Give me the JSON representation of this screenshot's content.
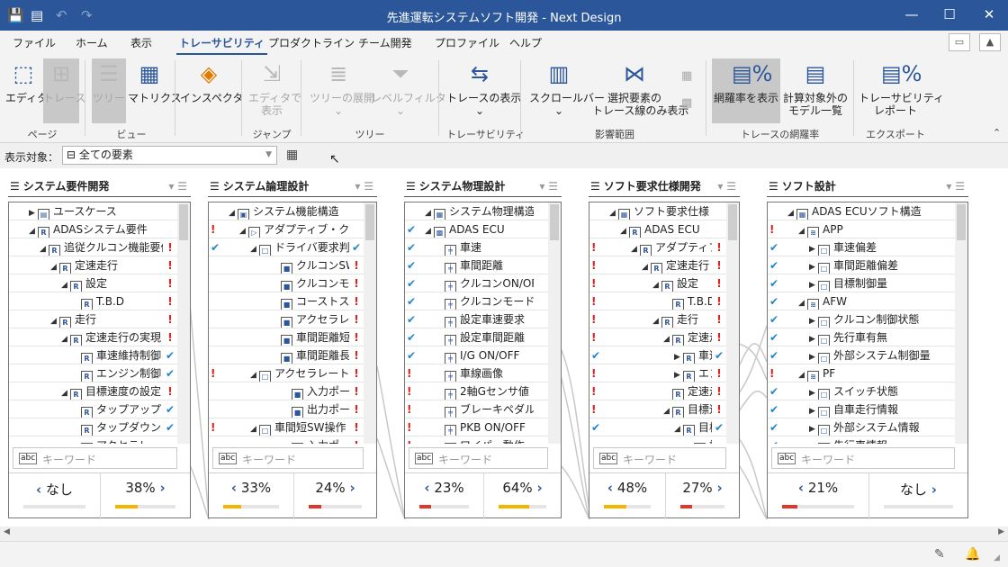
{
  "app": {
    "title": "先進運転システムソフト開発 - Next Design"
  },
  "menu_tabs": [
    "ファイル",
    "ホーム",
    "表示",
    "トレーサビリティ",
    "プロダクトライン",
    "チーム開発",
    "プロファイル",
    "ヘルプ"
  ],
  "ribbon": {
    "editor": "エディタ",
    "trace": "トレース",
    "tree": "ツリー",
    "matrix": "マトリクス",
    "inspector": "インスペクタ",
    "jump_editor_1": "エディタで",
    "jump_editor_2": "表示",
    "tree_expand": "ツリーの展開",
    "level_filter": "レベルフィルタ",
    "show_trace": "トレースの表示",
    "scrollbar": "スクロールバー",
    "selected_only_1": "選択要素の",
    "selected_only_2": "トレース線のみ表示",
    "coverage": "網羅率を表示",
    "excluded_1": "計算対象外の",
    "excluded_2": "モデル一覧",
    "report_1": "トレーサビリティ",
    "report_2": "レポート",
    "groups": {
      "page": "ページ",
      "view": "ビュー",
      "jump": "ジャンプ",
      "tree": "ツリー",
      "traceability": "トレーサビリティ",
      "impact": "影響範囲",
      "coverage": "トレースの網羅率",
      "export": "エクスポート"
    }
  },
  "target": {
    "label": "表示対象：",
    "value": "全ての要素"
  },
  "search_placeholder": "キーワード",
  "panels": [
    {
      "title": "システム要件開発",
      "left_value": "なし",
      "right_value": "38%",
      "left_pct": 0,
      "right_pct": 38,
      "left_color": "#f4b400",
      "right_color": "#f4b400",
      "rows": [
        {
          "l": "",
          "r": "",
          "d": 1,
          "e": "▶",
          "i": "▤",
          "t": "ユースケース"
        },
        {
          "l": "",
          "r": "",
          "d": 1,
          "e": "◢",
          "i": "R",
          "t": "ADASシステム要件"
        },
        {
          "l": "",
          "r": "!",
          "d": 2,
          "e": "◢",
          "i": "R",
          "t": "追従クルコン機能要件"
        },
        {
          "l": "",
          "r": "!",
          "d": 3,
          "e": "◢",
          "i": "R",
          "t": "定速走行"
        },
        {
          "l": "",
          "r": "!",
          "d": 4,
          "e": "◢",
          "i": "R",
          "t": "設定"
        },
        {
          "l": "",
          "r": "!",
          "d": 5,
          "e": "",
          "i": "R",
          "t": "T.B.D"
        },
        {
          "l": "",
          "r": "!",
          "d": 3,
          "e": "◢",
          "i": "R",
          "t": "走行"
        },
        {
          "l": "",
          "r": "!",
          "d": 4,
          "e": "◢",
          "i": "R",
          "t": "定速走行の実現"
        },
        {
          "l": "",
          "r": "✔",
          "d": 5,
          "e": "",
          "i": "R",
          "t": "車速維持制御"
        },
        {
          "l": "",
          "r": "✔",
          "d": 5,
          "e": "",
          "i": "R",
          "t": "エンジン制御"
        },
        {
          "l": "",
          "r": "!",
          "d": 4,
          "e": "◢",
          "i": "R",
          "t": "目標速度の設定"
        },
        {
          "l": "",
          "r": "✔",
          "d": 5,
          "e": "",
          "i": "R",
          "t": "タップアップ"
        },
        {
          "l": "",
          "r": "✔",
          "d": 5,
          "e": "",
          "i": "R",
          "t": "タップダウン"
        },
        {
          "l": "",
          "r": "",
          "d": 5,
          "e": "",
          "i": "R",
          "t": "アクセラレート"
        }
      ]
    },
    {
      "title": "システム論理設計",
      "left_value": "33%",
      "right_value": "24%",
      "left_pct": 33,
      "right_pct": 24,
      "left_color": "#f4b400",
      "right_color": "#e0382b",
      "rows": [
        {
          "l": "",
          "r": "",
          "d": 1,
          "e": "◢",
          "i": "▣",
          "t": "システム機能構造"
        },
        {
          "l": "!",
          "r": "",
          "d": 2,
          "e": "◢",
          "i": "▷",
          "t": "アダプティブ・クルーズコントロール"
        },
        {
          "l": "✔",
          "r": "✔",
          "d": 3,
          "e": "◢",
          "i": "□",
          "t": "ドライバ要求判定"
        },
        {
          "l": "",
          "r": "!",
          "d": 5,
          "e": "",
          "i": "■",
          "t": "クルコンSW ON/OFF"
        },
        {
          "l": "",
          "r": "!",
          "d": 5,
          "e": "",
          "i": "■",
          "t": "クルコンモード"
        },
        {
          "l": "",
          "r": "!",
          "d": 5,
          "e": "",
          "i": "■",
          "t": "コーストスW"
        },
        {
          "l": "",
          "r": "!",
          "d": 5,
          "e": "",
          "i": "■",
          "t": "アクセラレートSW"
        },
        {
          "l": "",
          "r": "!",
          "d": 5,
          "e": "",
          "i": "■",
          "t": "車間距離短縮"
        },
        {
          "l": "",
          "r": "!",
          "d": 5,
          "e": "",
          "i": "■",
          "t": "車間距離長縮"
        },
        {
          "l": "!",
          "r": "!",
          "d": 3,
          "e": "◢",
          "i": "□",
          "t": "アクセラレート判定"
        },
        {
          "l": "",
          "r": "!",
          "d": 6,
          "e": "",
          "i": "■",
          "t": "入力ポート"
        },
        {
          "l": "",
          "r": "!",
          "d": 6,
          "e": "",
          "i": "■",
          "t": "出力ポート"
        },
        {
          "l": "!",
          "r": "!",
          "d": 3,
          "e": "◢",
          "i": "□",
          "t": "車間短SW操作"
        },
        {
          "l": "",
          "r": "!",
          "d": 6,
          "e": "",
          "i": "■",
          "t": "入力ポート"
        }
      ]
    },
    {
      "title": "システム物理設計",
      "left_value": "23%",
      "right_value": "64%",
      "left_pct": 23,
      "right_pct": 64,
      "left_color": "#e0382b",
      "right_color": "#f4b400",
      "rows": [
        {
          "l": "",
          "r": "",
          "d": 1,
          "e": "◢",
          "i": "▦",
          "t": "システム物理構造"
        },
        {
          "l": "✔",
          "r": "",
          "d": 1,
          "e": "◢",
          "i": "▩",
          "t": "ADAS ECU"
        },
        {
          "l": "✔",
          "r": "",
          "d": 2,
          "e": "",
          "i": "╪",
          "t": "車速"
        },
        {
          "l": "✔",
          "r": "",
          "d": 2,
          "e": "",
          "i": "╪",
          "t": "車間距離"
        },
        {
          "l": "✔",
          "r": "",
          "d": 2,
          "e": "",
          "i": "╪",
          "t": "クルコンON/OFF"
        },
        {
          "l": "✔",
          "r": "",
          "d": 2,
          "e": "",
          "i": "╪",
          "t": "クルコンモード"
        },
        {
          "l": "✔",
          "r": "",
          "d": 2,
          "e": "",
          "i": "╪",
          "t": "設定車速要求"
        },
        {
          "l": "✔",
          "r": "",
          "d": 2,
          "e": "",
          "i": "╪",
          "t": "設定車間距離"
        },
        {
          "l": "✔",
          "r": "",
          "d": 2,
          "e": "",
          "i": "╪",
          "t": "I/G ON/OFF"
        },
        {
          "l": "!",
          "r": "",
          "d": 2,
          "e": "",
          "i": "╪",
          "t": "車線画像"
        },
        {
          "l": "!",
          "r": "",
          "d": 2,
          "e": "",
          "i": "╪",
          "t": "2軸Gセンサ値"
        },
        {
          "l": "!",
          "r": "",
          "d": 2,
          "e": "",
          "i": "╪",
          "t": "ブレーキペダル"
        },
        {
          "l": "!",
          "r": "",
          "d": 2,
          "e": "",
          "i": "╪",
          "t": "PKB ON/OFF"
        },
        {
          "l": "!",
          "r": "",
          "d": 2,
          "e": "",
          "i": "╪",
          "t": "ワイパー動作"
        }
      ]
    },
    {
      "title": "ソフト要求仕様開発",
      "left_value": "48%",
      "right_value": "27%",
      "left_pct": 48,
      "right_pct": 27,
      "left_color": "#f4b400",
      "right_color": "#e0382b",
      "rows": [
        {
          "l": "",
          "r": "",
          "d": 1,
          "e": "◢",
          "i": "▦",
          "t": "ソフト要求仕様"
        },
        {
          "l": "",
          "r": "",
          "d": 2,
          "e": "◢",
          "i": "R",
          "t": "ADAS ECU"
        },
        {
          "l": "!",
          "r": "!",
          "d": 3,
          "e": "◢",
          "i": "R",
          "t": "アダプティブクルコン"
        },
        {
          "l": "!",
          "r": "!",
          "d": 4,
          "e": "◢",
          "i": "R",
          "t": "定速走行"
        },
        {
          "l": "!",
          "r": "!",
          "d": 5,
          "e": "◢",
          "i": "R",
          "t": "設定"
        },
        {
          "l": "!",
          "r": "!",
          "d": 6,
          "e": "",
          "i": "R",
          "t": "T.B.D"
        },
        {
          "l": "!",
          "r": "!",
          "d": 5,
          "e": "◢",
          "i": "R",
          "t": "走行"
        },
        {
          "l": "!",
          "r": "!",
          "d": 6,
          "e": "◢",
          "i": "R",
          "t": "定速走行の実現"
        },
        {
          "l": "✔",
          "r": "✔",
          "d": 7,
          "e": "▶",
          "i": "R",
          "t": "車速維持制御"
        },
        {
          "l": "!",
          "r": "!",
          "d": 7,
          "e": "▶",
          "i": "R",
          "t": "エンジン制御"
        },
        {
          "l": "!",
          "r": "!",
          "d": 6,
          "e": "",
          "i": "R",
          "t": "定速走行"
        },
        {
          "l": "!",
          "r": "!",
          "d": 6,
          "e": "◢",
          "i": "R",
          "t": "目標速度"
        },
        {
          "l": "✔",
          "r": "✔",
          "d": 7,
          "e": "◢",
          "i": "R",
          "t": "目標速度設定"
        },
        {
          "l": "",
          "r": "",
          "d": 8,
          "e": "",
          "i": "□",
          "t": "設定"
        }
      ]
    },
    {
      "title": "ソフト設計",
      "left_value": "21%",
      "right_value": "なし",
      "left_pct": 21,
      "right_pct": 0,
      "left_color": "#e0382b",
      "right_color": "#e0382b",
      "rows": [
        {
          "l": "",
          "r": "",
          "d": 1,
          "e": "◢",
          "i": "▦",
          "t": "ADAS ECUソフト構造"
        },
        {
          "l": "!",
          "r": "",
          "d": 2,
          "e": "◢",
          "i": "≋",
          "t": "APP"
        },
        {
          "l": "✔",
          "r": "",
          "d": 3,
          "e": "▶",
          "i": "□",
          "t": "車速偏差"
        },
        {
          "l": "✔",
          "r": "",
          "d": 3,
          "e": "▶",
          "i": "□",
          "t": "車間距離偏差"
        },
        {
          "l": "✔",
          "r": "",
          "d": 3,
          "e": "▶",
          "i": "□",
          "t": "目標制御量"
        },
        {
          "l": "✔",
          "r": "",
          "d": 2,
          "e": "◢",
          "i": "≋",
          "t": "AFW"
        },
        {
          "l": "✔",
          "r": "",
          "d": 3,
          "e": "▶",
          "i": "□",
          "t": "クルコン制御状態"
        },
        {
          "l": "✔",
          "r": "",
          "d": 3,
          "e": "▶",
          "i": "□",
          "t": "先行車有無"
        },
        {
          "l": "✔",
          "r": "",
          "d": 3,
          "e": "▶",
          "i": "□",
          "t": "外部システム制御量"
        },
        {
          "l": "!",
          "r": "",
          "d": 2,
          "e": "◢",
          "i": "≋",
          "t": "PF"
        },
        {
          "l": "✔",
          "r": "",
          "d": 3,
          "e": "▶",
          "i": "□",
          "t": "スイッチ状態"
        },
        {
          "l": "✔",
          "r": "",
          "d": 3,
          "e": "▶",
          "i": "□",
          "t": "自車走行情報"
        },
        {
          "l": "✔",
          "r": "",
          "d": 3,
          "e": "▶",
          "i": "□",
          "t": "外部システム情報"
        },
        {
          "l": "✔",
          "r": "",
          "d": 3,
          "e": "▶",
          "i": "□",
          "t": "先行車情報"
        }
      ]
    }
  ]
}
